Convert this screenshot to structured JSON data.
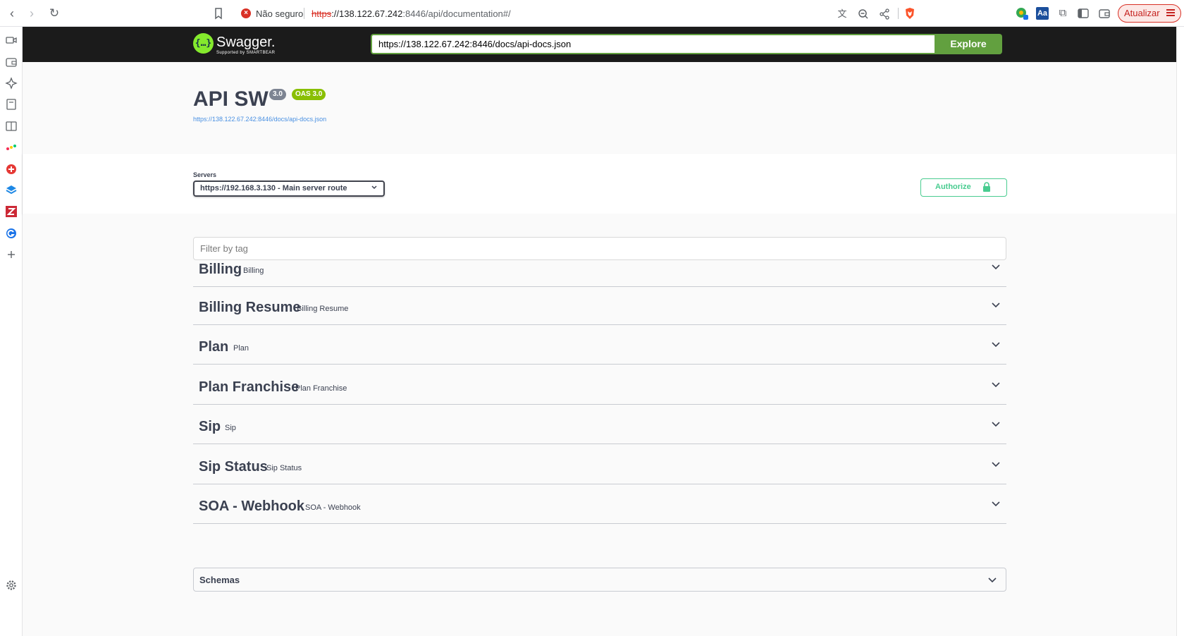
{
  "browser": {
    "security_label": "Não seguro",
    "url_scheme": "https",
    "url_host": "://138.122.67.242",
    "url_rest": ":8446/api/documentation#/",
    "update_label": "Atualizar",
    "extension_2_label": "Aa"
  },
  "topbar": {
    "logo_symbol": "{…}",
    "logo_text": "Swagger.",
    "logo_sub": "Supported by SMARTBEAR",
    "spec_url": "https://138.122.67.242:8446/docs/api-docs.json",
    "explore_label": "Explore"
  },
  "info": {
    "title": "API SW",
    "version_badge": "3.0",
    "oas_badge": "OAS 3.0",
    "spec_link": "https://138.122.67.242:8446/docs/api-docs.json"
  },
  "servers": {
    "label": "Servers",
    "selected": "https://192.168.3.130 - Main server route",
    "authorize_label": "Authorize"
  },
  "filter": {
    "placeholder": "Filter by tag"
  },
  "tags": [
    {
      "name": "Billing",
      "description": "Billing"
    },
    {
      "name": "Billing Resume",
      "description": "Billing Resume"
    },
    {
      "name": "Plan",
      "description": "Plan"
    },
    {
      "name": "Plan Franchise",
      "description": "Plan Franchise"
    },
    {
      "name": "Sip",
      "description": "Sip"
    },
    {
      "name": "Sip Status",
      "description": "Sip Status"
    },
    {
      "name": "SOA - Webhook",
      "description": "SOA - Webhook"
    }
  ],
  "schemas": {
    "label": "Schemas"
  },
  "colors": {
    "swagger_green": "#62a03f",
    "authorize_green": "#49cc90",
    "oas_badge": "#89bf04",
    "version_badge": "#7d8492",
    "topbar_bg": "#1b1b1b"
  }
}
